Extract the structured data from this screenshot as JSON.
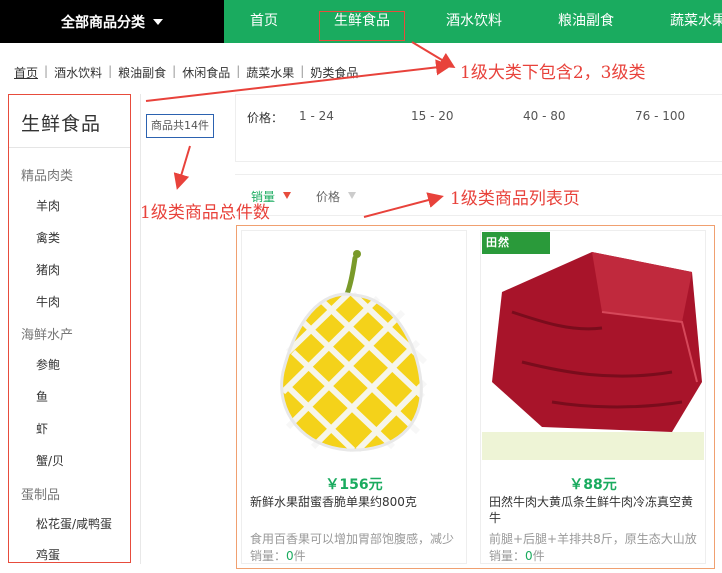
{
  "nav": {
    "all_categories": "全部商品分类",
    "items": [
      "首页",
      "生鲜食品",
      "酒水饮料",
      "粮油副食",
      "蔬菜水果"
    ]
  },
  "breadcrumb": [
    "首页",
    "酒水饮料",
    "粮油副食",
    "休闲食品",
    "蔬菜水果",
    "奶类食品"
  ],
  "annotations": {
    "levels": "1级大类下包含2，3级类",
    "total": "1级类商品总件数",
    "list": "1级类商品列表页"
  },
  "sidebar": {
    "title": "生鲜食品",
    "total_label": "商品共14件",
    "groups": [
      {
        "name": "精品肉类",
        "items": [
          "羊肉",
          "禽类",
          "猪肉",
          "牛肉"
        ]
      },
      {
        "name": "海鲜水产",
        "items": [
          "参鲍",
          "鱼",
          "虾",
          "蟹/贝"
        ]
      },
      {
        "name": "蛋制品",
        "items": [
          "松花蛋/咸鸭蛋",
          "鸡蛋"
        ]
      }
    ]
  },
  "price_filter": {
    "label": "价格：",
    "ranges": [
      "1 - 24",
      "15 - 20",
      "40 - 80",
      "76 - 100"
    ]
  },
  "sort": {
    "sales": "销量",
    "price": "价格"
  },
  "products": [
    {
      "price": "￥156元",
      "name": "新鲜水果甜蜜香脆单果约800克",
      "desc": "食用百香果可以增加胃部饱腹感，减少",
      "sales_label": "销量：",
      "sales_count": "0",
      "sales_unit": "件"
    },
    {
      "price": "￥88元",
      "name": "田然牛肉大黄瓜条生鲜牛肉冷冻真空黄牛",
      "desc": "前腿+后腿+羊排共8斤，原生态大山放",
      "sales_label": "销量：",
      "sales_count": "0",
      "sales_unit": "件",
      "badge": "田然"
    }
  ],
  "colors": {
    "brand_green": "#1aab5f",
    "annotation_red": "#e8423b"
  }
}
